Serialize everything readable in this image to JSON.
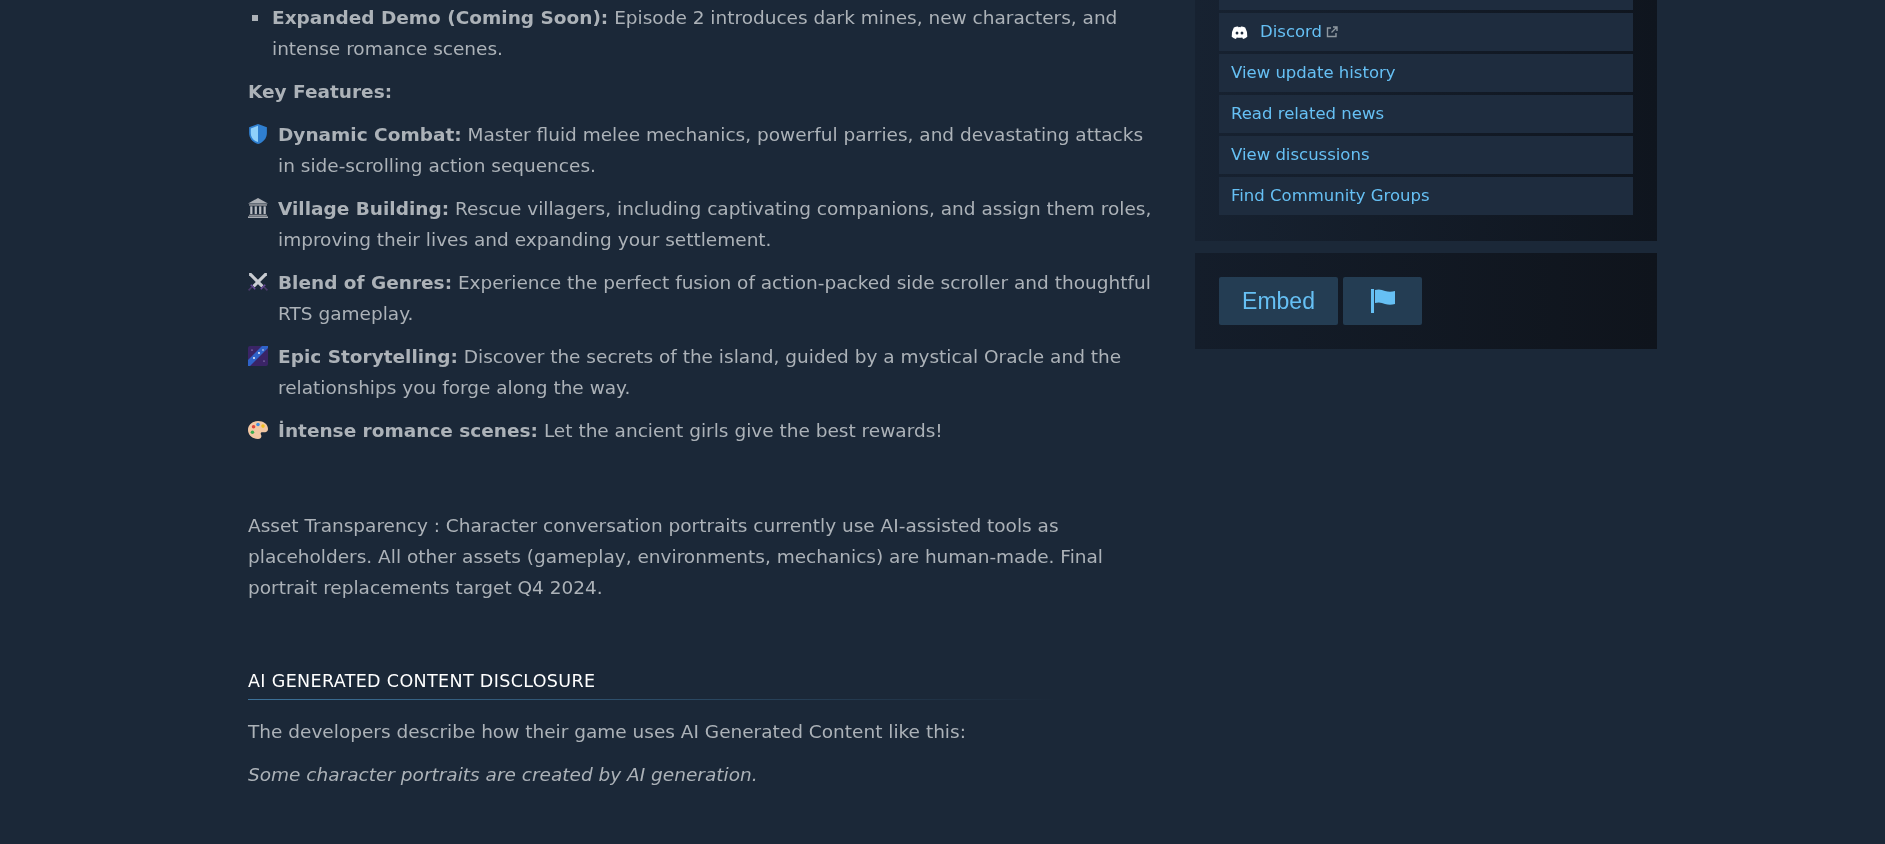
{
  "description": {
    "list_items": [
      {
        "text": "**Expanded Demo (Coming Soon):** Episode 2 introduces dark mines, new characters, and intense romance scenes."
      }
    ],
    "features_heading": "Key Features:",
    "features": [
      {
        "text": "**Dynamic Combat:** Master fluid melee mechanics, powerful parries, and devastating attacks in side-scrolling action sequences."
      },
      {
        "text": "**Village Building:** Rescue villagers, including captivating companions, and assign them roles, improving their lives and expanding your settlement."
      },
      {
        "text": "**Blend of Genres:** Experience the perfect fusion of action-packed side scroller and thoughtful RTS gameplay."
      },
      {
        "text": "**Epic Storytelling:** Discover the secrets of the island, guided by a mystical Oracle and the relationships you forge along the way."
      },
      {
        "text": "**İntense romance scenes:** Let the ancient girls give the best rewards!"
      }
    ],
    "transparency_note": "Asset Transparency : Character conversation portraits currently use AI-assisted tools as placeholders. All other assets (gameplay, environments, mechanics) are human-made. Final portrait replacements target Q4 2024."
  },
  "ai_disclosure": {
    "heading": "AI GENERATED CONTENT DISCLOSURE",
    "intro": "The developers describe how their game uses AI Generated Content like this:",
    "statement": "Some character portraits are created by AI generation."
  },
  "sidebar": {
    "links": [
      {
        "label": "Discord",
        "kind": "external"
      },
      {
        "label": "View update history",
        "kind": "plain"
      },
      {
        "label": "Read related news",
        "kind": "plain"
      },
      {
        "label": "View discussions",
        "kind": "plain"
      },
      {
        "label": "Find Community Groups",
        "kind": "plain"
      }
    ],
    "embed_button": {
      "label": "Embed"
    }
  }
}
